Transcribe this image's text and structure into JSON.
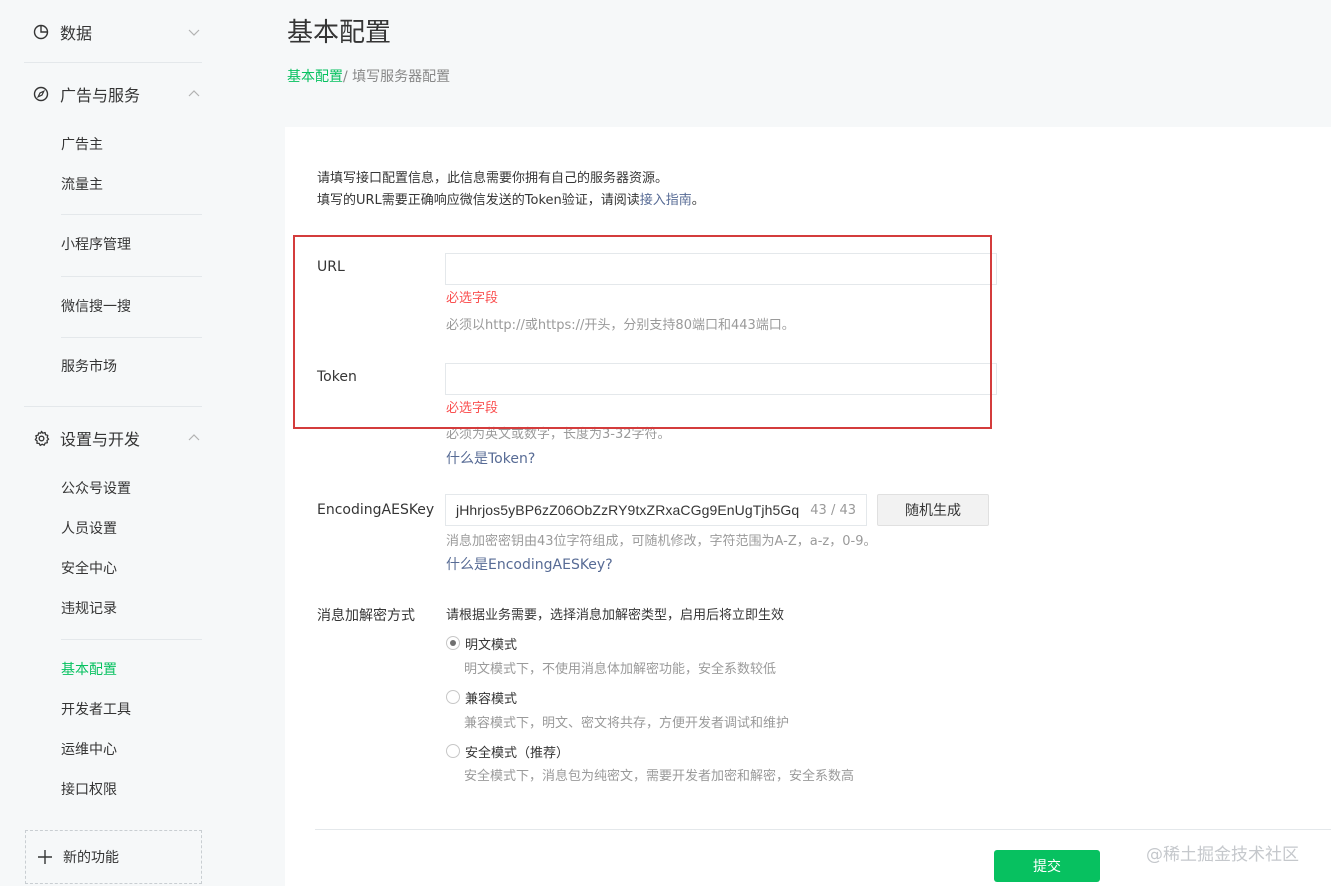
{
  "sidebar": {
    "data_section": {
      "title": "数据",
      "icon": "pie-chart-icon"
    },
    "ads_section": {
      "title": "广告与服务",
      "icon": "compass-icon",
      "items": [
        "广告主",
        "流量主",
        "小程序管理",
        "微信搜一搜",
        "服务市场"
      ]
    },
    "settings_section": {
      "title": "设置与开发",
      "icon": "gear-icon",
      "items": [
        "公众号设置",
        "人员设置",
        "安全中心",
        "违规记录",
        "基本配置",
        "开发者工具",
        "运维中心",
        "接口权限"
      ],
      "active_item": "基本配置"
    },
    "new_feature": "新的功能"
  },
  "header": {
    "title": "基本配置",
    "breadcrumb": [
      "基本配置",
      "/ 填写服务器配置"
    ]
  },
  "form": {
    "intro_line1": "请填写接口配置信息，此信息需要你拥有自己的服务器资源。",
    "intro_line2_prefix": "填写的URL需要正确响应微信发送的Token验证，请阅读",
    "intro_line2_link": "接入指南",
    "intro_line2_suffix": "。",
    "url": {
      "label": "URL",
      "value": "",
      "error": "必选字段",
      "tip": "必须以http://或https://开头，分别支持80端口和443端口。"
    },
    "token": {
      "label": "Token",
      "value": "",
      "error": "必选字段",
      "tip": "必须为英文或数字，长度为3-32字符。",
      "help": "什么是Token?"
    },
    "aes": {
      "label": "EncodingAESKey",
      "value": "jHhrjos5yBP6zZ06ObZzRY9txZRxaCGg9EnUgTjh5Gq",
      "count": "43 / 43",
      "random_button": "随机生成",
      "tip": "消息加密密钥由43位字符组成，可随机修改，字符范围为A-Z，a-z，0-9。",
      "help": "什么是EncodingAESKey?"
    },
    "encrypt": {
      "label": "消息加解密方式",
      "desc": "请根据业务需要，选择消息加解密类型，启用后将立即生效",
      "options": [
        {
          "label": "明文模式",
          "desc": "明文模式下，不使用消息体加解密功能，安全系数较低",
          "checked": true
        },
        {
          "label": "兼容模式",
          "desc": "兼容模式下，明文、密文将共存，方便开发者调试和维护",
          "checked": false
        },
        {
          "label": "安全模式（推荐）",
          "desc": "安全模式下，消息包为纯密文，需要开发者加密和解密，安全系数高",
          "checked": false
        }
      ]
    },
    "submit": "提交"
  },
  "watermark": "@稀土掘金技术社区",
  "colors": {
    "accent": "#07c160",
    "error": "#fa5151",
    "link": "#576b95",
    "highlight": "#d43c3c"
  }
}
